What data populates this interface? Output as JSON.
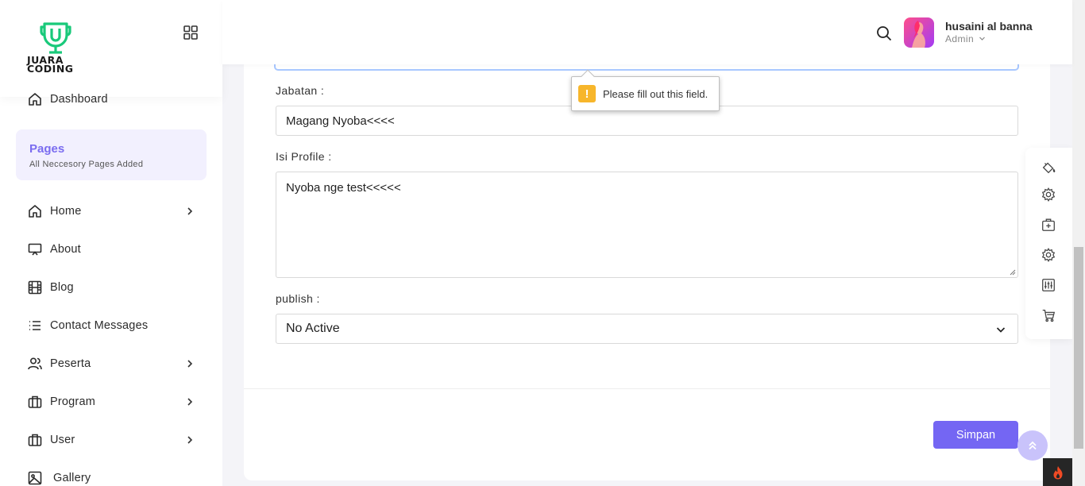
{
  "brand": {
    "name_line1": "JUARA",
    "name_line2": "CODING"
  },
  "sidebar": {
    "dashboard_label": "Dashboard",
    "pages_section": {
      "title": "Pages",
      "subtitle": "All Neccesory Pages Added"
    },
    "items": [
      {
        "label": "Home",
        "icon": "home-icon",
        "has_submenu": true
      },
      {
        "label": "About",
        "icon": "monitor-icon",
        "has_submenu": false
      },
      {
        "label": "Blog",
        "icon": "film-icon",
        "has_submenu": false
      },
      {
        "label": "Contact Messages",
        "icon": "list-icon",
        "has_submenu": false
      },
      {
        "label": "Peserta",
        "icon": "users-icon",
        "has_submenu": true
      },
      {
        "label": "Program",
        "icon": "briefcase-icon",
        "has_submenu": true
      },
      {
        "label": "User",
        "icon": "briefcase-icon",
        "has_submenu": true
      },
      {
        "label": "Gallery",
        "icon": "image-icon",
        "has_submenu": false
      }
    ]
  },
  "header": {
    "user_name": "husaini al banna",
    "user_role": "Admin"
  },
  "form": {
    "jabatan_label": "Jabatan :",
    "jabatan_value": "Magang Nyoba<<<<",
    "isi_profile_label": "Isi Profile :",
    "isi_profile_value": "Nyoba nge test<<<<<",
    "publish_label": "publish :",
    "publish_selected": "No Active",
    "save_label": "Simpan"
  },
  "validation_tooltip": {
    "text": "Please fill out this field."
  },
  "tools": [
    "paint-bucket-icon",
    "gear-icon",
    "medical-bag-icon",
    "gear-icon",
    "equalizer-icon",
    "cart-icon"
  ],
  "colors": {
    "accent": "#7466f3",
    "brand_green": "#2ecc71",
    "warning": "#f7b62b"
  }
}
